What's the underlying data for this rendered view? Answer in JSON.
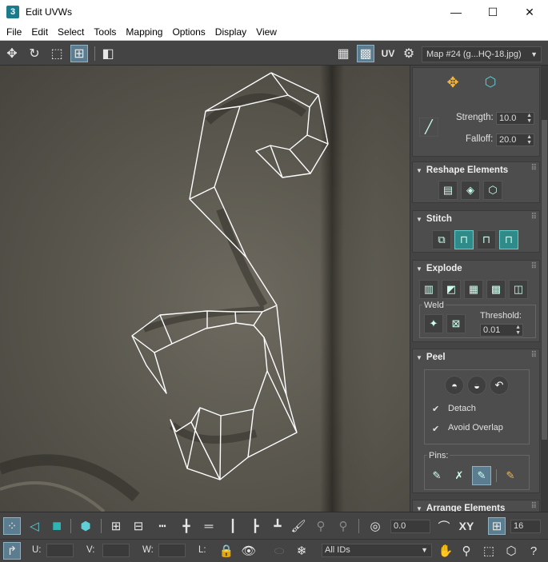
{
  "window": {
    "app_icon": "3",
    "title": "Edit UVWs",
    "min": "—",
    "max": "☐",
    "close": "✕"
  },
  "menu": [
    "File",
    "Edit",
    "Select",
    "Tools",
    "Mapping",
    "Options",
    "Display",
    "View"
  ],
  "toolbar_top": {
    "uv_label": "UV",
    "map_select": "Map #24 (g...HQ-18.jpg)"
  },
  "panel": {
    "brush": {
      "strength_label": "Strength:",
      "strength": "10.0",
      "falloff_label": "Falloff:",
      "falloff": "20.0"
    },
    "reshape": {
      "title": "Reshape Elements"
    },
    "stitch": {
      "title": "Stitch"
    },
    "explode": {
      "title": "Explode",
      "weld_label": "Weld",
      "threshold_label": "Threshold:",
      "threshold": "0.01"
    },
    "peel": {
      "title": "Peel",
      "detach": "Detach",
      "avoid_overlap": "Avoid Overlap",
      "pins_label": "Pins:"
    },
    "arrange": {
      "title": "Arrange Elements"
    }
  },
  "toolbar_bottom": {
    "angle_value": "0.0",
    "xy_label": "XY",
    "grid_value": "16",
    "u_label": "U:",
    "v_label": "V:",
    "w_label": "W:",
    "l_label": "L:",
    "id_select": "All IDs"
  },
  "colors": {
    "accent": "#5b7d8f",
    "teal": "#2f8a8a",
    "panel_bg": "#444444",
    "uv_wire": "#ffffff"
  }
}
